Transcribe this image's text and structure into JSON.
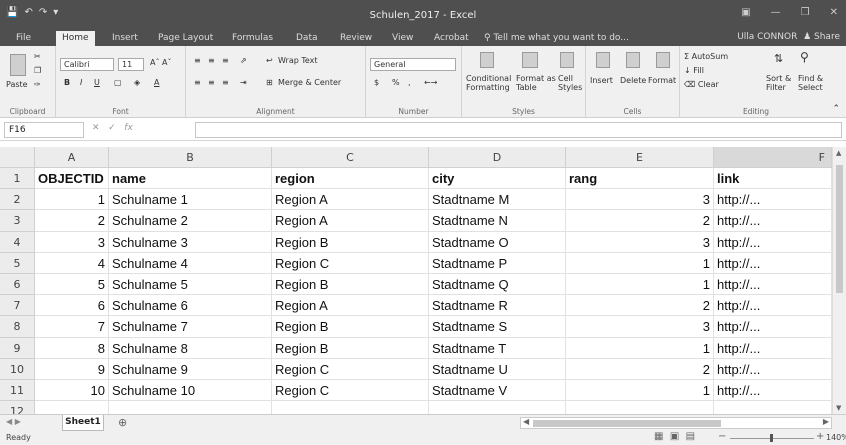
{
  "window": {
    "title": "Schulen_2017 - Excel"
  },
  "ribbon_tabs": [
    "File",
    "Home",
    "Insert",
    "Page Layout",
    "Formulas",
    "Data",
    "Review",
    "View",
    "Acrobat"
  ],
  "tell_me": "Tell me what you want to do...",
  "user": {
    "name": "Ulla CONNOR",
    "share": "Share"
  },
  "ribbon": {
    "paste": "Paste",
    "clipboard": "Clipboard",
    "font_name": "Calibri",
    "font_size": "11",
    "font": "Font",
    "wrap_text": "Wrap Text",
    "merge_center": "Merge & Center",
    "alignment": "Alignment",
    "number_format": "General",
    "currency": "$",
    "percent": "%",
    "comma": ",",
    "number": "Number",
    "cond_format_1": "Conditional",
    "cond_format_2": "Formatting",
    "format_table_1": "Format as",
    "format_table_2": "Table",
    "cell_styles_1": "Cell",
    "cell_styles_2": "Styles",
    "styles": "Styles",
    "insert": "Insert",
    "delete": "Delete",
    "format": "Format",
    "cells": "Cells",
    "autosum": "AutoSum",
    "fill": "Fill",
    "clear": "Clear",
    "sort_1": "Sort &",
    "sort_2": "Filter",
    "find_1": "Find &",
    "find_2": "Select",
    "editing": "Editing"
  },
  "formula_bar": {
    "name_box": "F16",
    "fx": "fx",
    "formula": ""
  },
  "columns": [
    "A",
    "B",
    "C",
    "D",
    "E",
    "F"
  ],
  "rows": [
    "1",
    "2",
    "3",
    "4",
    "5",
    "6",
    "7",
    "8",
    "9",
    "10",
    "11",
    "12"
  ],
  "headers": [
    "OBJECTID",
    "name",
    "region",
    "city",
    "rang",
    "link"
  ],
  "data": [
    [
      "1",
      "Schulname 1",
      "Region A",
      "Stadtname M",
      "3",
      "http://..."
    ],
    [
      "2",
      "Schulname 2",
      "Region A",
      "Stadtname N",
      "2",
      "http://..."
    ],
    [
      "3",
      "Schulname 3",
      "Region B",
      "Stadtname O",
      "3",
      "http://..."
    ],
    [
      "4",
      "Schulname 4",
      "Region C",
      "Stadtname P",
      "1",
      "http://..."
    ],
    [
      "5",
      "Schulname 5",
      "Region B",
      "Stadtname Q",
      "1",
      "http://..."
    ],
    [
      "6",
      "Schulname 6",
      "Region A",
      "Stadtname R",
      "2",
      "http://..."
    ],
    [
      "7",
      "Schulname 7",
      "Region B",
      "Stadtname S",
      "3",
      "http://..."
    ],
    [
      "8",
      "Schulname 8",
      "Region B",
      "Stadtname T",
      "1",
      "http://..."
    ],
    [
      "9",
      "Schulname 9",
      "Region C",
      "Stadtname U",
      "2",
      "http://..."
    ],
    [
      "10",
      "Schulname 10",
      "Region C",
      "Stadtname V",
      "1",
      "http://..."
    ]
  ],
  "sheets": [
    "Sheet1"
  ],
  "status": {
    "ready": "Ready",
    "zoom": "140%"
  }
}
